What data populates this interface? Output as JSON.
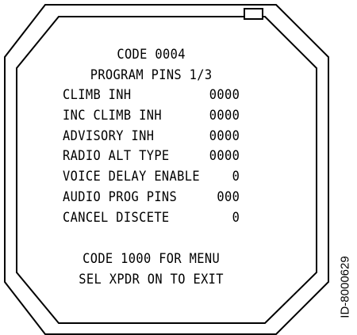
{
  "display": {
    "header": {
      "code_line": "CODE 0004",
      "page_line": "PROGRAM PINS 1/3"
    },
    "rows": [
      {
        "label": "CLIMB INH",
        "value": "0000"
      },
      {
        "label": "INC CLIMB INH",
        "value": "0000"
      },
      {
        "label": "ADVISORY INH",
        "value": "0000"
      },
      {
        "label": "RADIO ALT TYPE",
        "value": "0000"
      },
      {
        "label": "VOICE DELAY ENABLE",
        "value": "0"
      },
      {
        "label": "AUDIO PROG PINS",
        "value": "000"
      },
      {
        "label": "CANCEL DISCETE",
        "value": "0"
      }
    ],
    "footer": {
      "menu_line": "CODE 1000 FOR MENU",
      "exit_line": "SEL XPDR ON TO EXIT"
    }
  },
  "figure_id": "ID-8000629",
  "colors": {
    "ink": "#000000",
    "background": "#ffffff"
  },
  "icons": {
    "indicator": "status-indicator-rectangle"
  }
}
